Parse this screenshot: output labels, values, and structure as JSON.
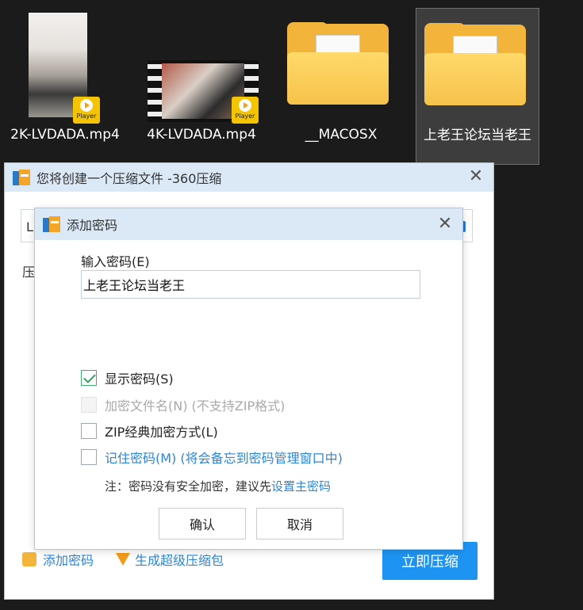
{
  "desktop": {
    "files": [
      {
        "name": "2K-LVDADA.mp4",
        "badge": "Player"
      },
      {
        "name": "4K-LVDADA.mp4",
        "badge": "Player"
      },
      {
        "name": "__MACOSX"
      },
      {
        "name": "上老王论坛当老王"
      }
    ]
  },
  "main_window": {
    "title": "您将创建一个压缩文件 -360压缩",
    "path_value": "L",
    "side_label": "压",
    "add_password_link": "添加密码",
    "super_package_link": "生成超级压缩包",
    "compress_button": "立即压缩"
  },
  "password_dialog": {
    "title": "添加密码",
    "input_label": "输入密码(E)",
    "password_value": "上老王论坛当老王",
    "options": {
      "show_password": {
        "label": "显示密码(S)",
        "checked": true
      },
      "encrypt_filename": {
        "label": "加密文件名(N) (不支持ZIP格式)",
        "checked": false,
        "disabled": true
      },
      "zip_classic": {
        "label": "ZIP经典加密方式(L)",
        "checked": false
      },
      "remember": {
        "label": "记住密码(M) (将会备忘到密码管理窗口中)",
        "checked": false
      }
    },
    "note_text": "注：密码没有安全加密，建议先",
    "note_link": "设置主密码",
    "ok_button": "确认",
    "cancel_button": "取消"
  },
  "colors": {
    "accent": "#2a86d6",
    "title_bar": "#dbe9f7",
    "primary_button": "#1e94f2",
    "check_green": "#2ea35a"
  }
}
